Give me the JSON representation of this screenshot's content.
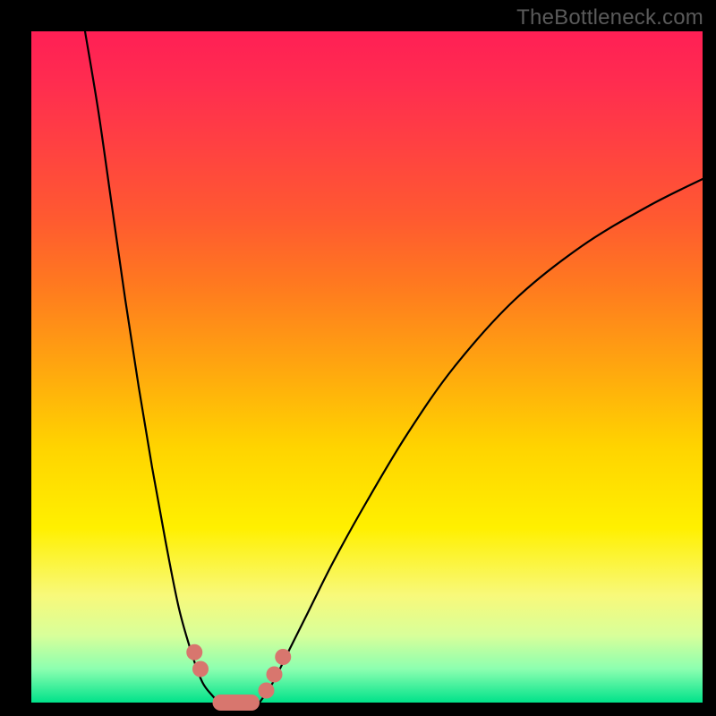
{
  "watermark": "TheBottleneck.com",
  "colors": {
    "frame": "#000000",
    "gradient_top": "#ff1f55",
    "gradient_mid": "#ffd400",
    "gradient_bottom": "#00e28a",
    "curve": "#000000",
    "marker": "#d8766e"
  },
  "chart_data": {
    "type": "line",
    "title": "",
    "xlabel": "",
    "ylabel": "",
    "xlim": [
      0,
      100
    ],
    "ylim": [
      0,
      100
    ],
    "series": [
      {
        "name": "left-curve",
        "x": [
          8,
          10,
          12,
          14,
          16,
          18,
          20,
          22,
          24,
          25.5,
          27,
          28
        ],
        "y": [
          100,
          88,
          74,
          60,
          47,
          35,
          24,
          14,
          7,
          3,
          1,
          0
        ]
      },
      {
        "name": "flat-bottom",
        "x": [
          28,
          34
        ],
        "y": [
          0,
          0
        ]
      },
      {
        "name": "right-curve",
        "x": [
          34,
          36,
          38,
          41,
          45,
          50,
          56,
          63,
          72,
          82,
          92,
          100
        ],
        "y": [
          0,
          3,
          7,
          13,
          21,
          30,
          40,
          50,
          60,
          68,
          74,
          78
        ]
      }
    ],
    "markers": [
      {
        "shape": "circle",
        "x": 24.3,
        "y": 7.5
      },
      {
        "shape": "circle",
        "x": 25.2,
        "y": 5.0
      },
      {
        "shape": "pill",
        "x": 30.5,
        "y": 0.0,
        "w": 7.0
      },
      {
        "shape": "circle",
        "x": 35.0,
        "y": 1.8
      },
      {
        "shape": "circle",
        "x": 36.2,
        "y": 4.2
      },
      {
        "shape": "circle",
        "x": 37.5,
        "y": 6.8
      }
    ]
  }
}
